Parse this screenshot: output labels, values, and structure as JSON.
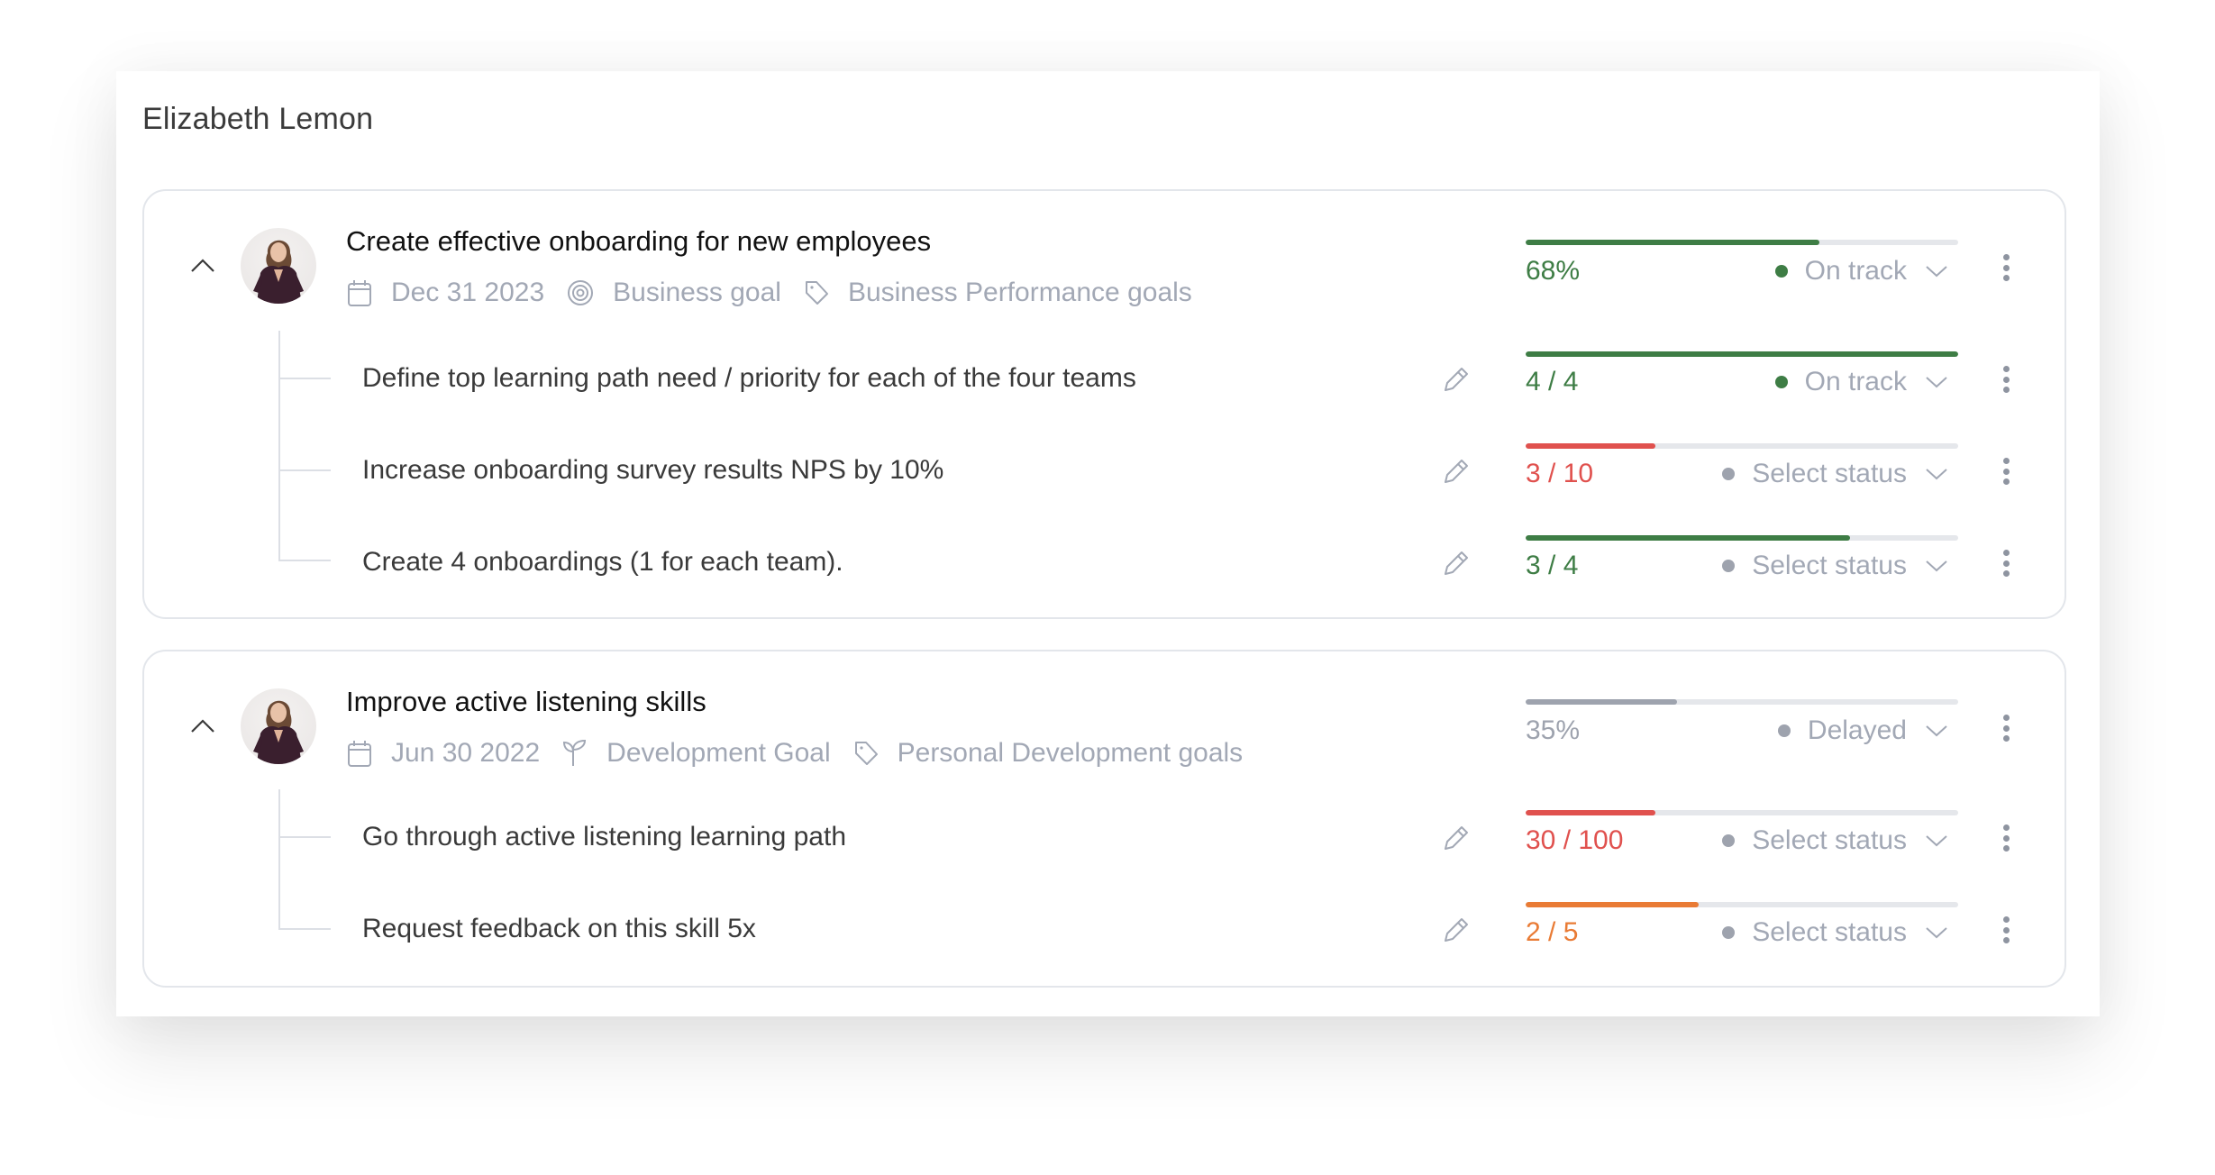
{
  "person": {
    "name": "Elizabeth Lemon"
  },
  "colors": {
    "green": "#3e7d45",
    "red": "#e0514e",
    "orange": "#e97b35",
    "gray": "#9ea3ae",
    "track": "#e5e7eb",
    "meta_text": "#a2a8b5"
  },
  "goals": [
    {
      "title": "Create effective onboarding for new employees",
      "expanded": true,
      "date": "Dec 31 2023",
      "type_icon": "target-icon",
      "type": "Business goal",
      "category_icon": "tag-icon",
      "category": "Business Performance goals",
      "progress_label": "68%",
      "progress": 0.68,
      "progress_color": "#3e7d45",
      "status": "On track",
      "status_color": "#3e7d45",
      "key_results": [
        {
          "title": "Define top learning path need / priority for each of the four teams",
          "progress_label": "4 / 4",
          "progress": 1.0,
          "color": "#3e7d45",
          "status": "On track",
          "status_color": "#3e7d45"
        },
        {
          "title": "Increase onboarding survey results NPS by 10%",
          "progress_label": "3 / 10",
          "progress": 0.3,
          "color": "#e0514e",
          "status": "Select status",
          "status_color": "#9ea3ae"
        },
        {
          "title": "Create 4 onboardings (1 for each team).",
          "progress_label": "3 / 4",
          "progress": 0.75,
          "color": "#3e7d45",
          "status": "Select status",
          "status_color": "#9ea3ae"
        }
      ]
    },
    {
      "title": "Improve active listening skills",
      "expanded": true,
      "date": "Jun 30 2022",
      "type_icon": "sprout-icon",
      "type": "Development Goal",
      "category_icon": "tag-icon",
      "category": "Personal Development goals",
      "progress_label": "35%",
      "progress": 0.35,
      "progress_color": "#9ea3ae",
      "status": "Delayed",
      "status_color": "#9ea3ae",
      "key_results": [
        {
          "title": "Go through active listening learning path",
          "progress_label": "30 / 100",
          "progress": 0.3,
          "color": "#e0514e",
          "status": "Select status",
          "status_color": "#9ea3ae"
        },
        {
          "title": "Request feedback on this skill 5x",
          "progress_label": "2 / 5",
          "progress": 0.4,
          "color": "#e97b35",
          "status": "Select status",
          "status_color": "#9ea3ae"
        }
      ]
    }
  ]
}
